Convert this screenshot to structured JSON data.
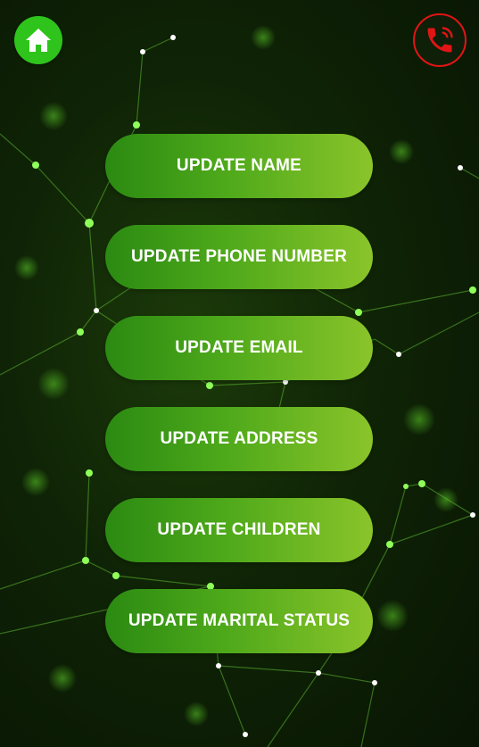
{
  "header": {
    "home_icon": "home-icon",
    "call_icon": "phone-call-icon"
  },
  "menu": {
    "items": [
      {
        "label": "UPDATE NAME"
      },
      {
        "label": "UPDATE PHONE NUMBER"
      },
      {
        "label": "UPDATE EMAIL"
      },
      {
        "label": "UPDATE ADDRESS"
      },
      {
        "label": "UPDATE CHILDREN"
      },
      {
        "label": "UPDATE MARITAL STATUS"
      }
    ]
  },
  "colors": {
    "home_button": "#2fc41c",
    "call_button_border": "#e01515",
    "button_gradient_start": "#2b8a12",
    "button_gradient_end": "#8ac42a"
  }
}
